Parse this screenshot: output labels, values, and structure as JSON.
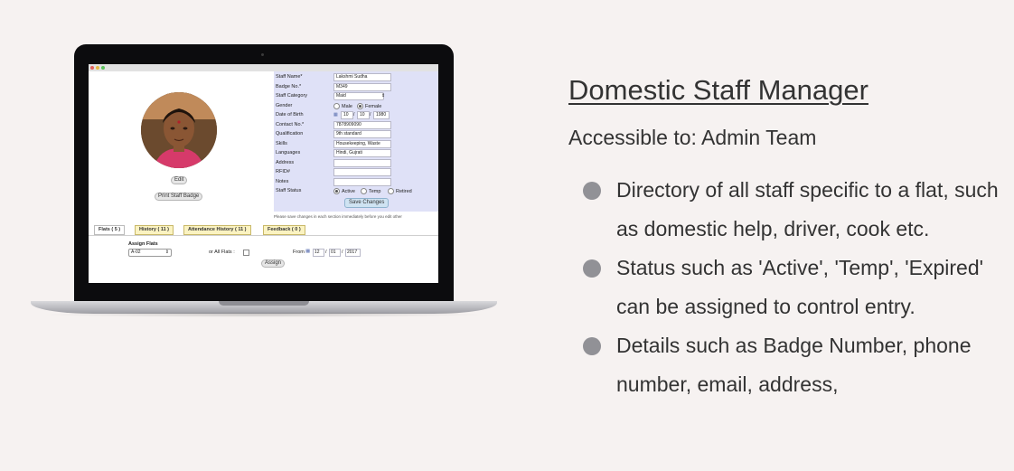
{
  "staff_form": {
    "fields": [
      {
        "label": "Staff Name*",
        "value": "Lakshmi Sudha"
      },
      {
        "label": "Badge No.*",
        "value": "M349"
      },
      {
        "label": "Staff Category",
        "value": "Maid"
      },
      {
        "label": "Gender",
        "options": [
          "Male",
          "Female"
        ],
        "selected": "Female"
      },
      {
        "label": "Date of Birth",
        "day": "10",
        "month": "10",
        "year": "1980"
      },
      {
        "label": "Contact No.*",
        "value": "7878909090"
      },
      {
        "label": "Qualification",
        "value": "9th standard"
      },
      {
        "label": "Skills",
        "value": "Housekeeping, Waste"
      },
      {
        "label": "Languages",
        "value": "Hindi, Gujrati"
      },
      {
        "label": "Address",
        "value": ""
      },
      {
        "label": "RFID#",
        "value": ""
      },
      {
        "label": "Notes",
        "value": ""
      },
      {
        "label": "Staff Status",
        "options": [
          "Active",
          "Temp",
          "Retired"
        ],
        "selected": "Active"
      }
    ],
    "save_label": "Save Changes",
    "note": "Please save changes in each section immediately before you edit other",
    "edit_label": "Edit",
    "print_badge_label": "Print Staff Badge"
  },
  "tabs": [
    {
      "label": "Flats ( 5 )",
      "active": true
    },
    {
      "label": "History ( 11 )",
      "active": false
    },
    {
      "label": "Attendance History ( 11 )",
      "active": false
    },
    {
      "label": "Feedback ( 0 )",
      "active": false
    }
  ],
  "assign": {
    "heading": "Assign Flats",
    "flat_value": "A-02",
    "all_flats_label": "or All Flats :",
    "from_label": "From",
    "from_day": "12",
    "from_month": "01",
    "from_year": "2017",
    "assign_label": "Assign"
  },
  "title": "Domestic Staff Manager",
  "accessible": "Accessible to: Admin Team",
  "bullets": [
    "Directory of all staff specific to a flat, such as domestic help, driver, cook etc.",
    "Status such as 'Active', 'Temp', 'Expired' can be assigned to control entry.",
    "Details such as Badge Number, phone number, email, address,"
  ],
  "colors": {
    "background": "#f6f2f1",
    "form_panel": "#dfe1f7",
    "tab_inactive": "#fbf3c1",
    "bullet_dot": "#919196",
    "text": "#333333"
  }
}
